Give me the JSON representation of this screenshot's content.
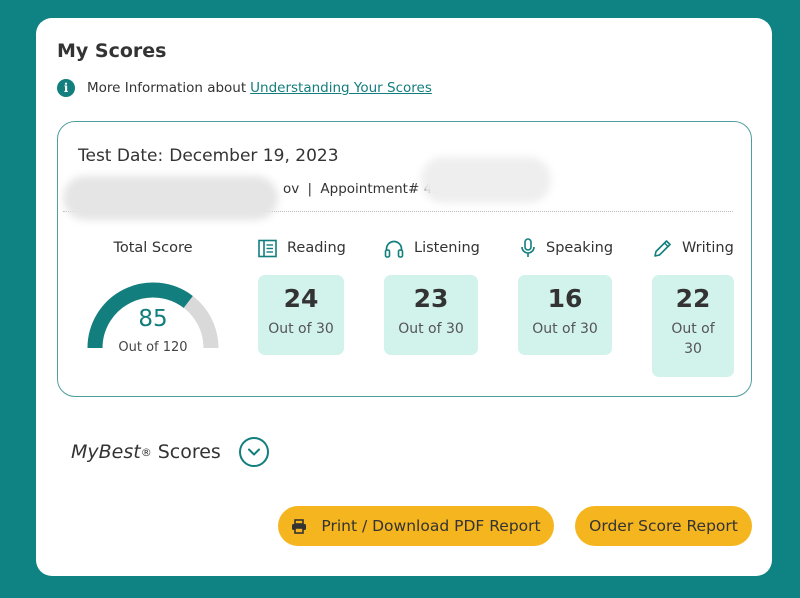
{
  "title": "My Scores",
  "info": {
    "text": "More Information about",
    "link": "Understanding Your Scores"
  },
  "test": {
    "date_label": "Test Date:",
    "date_value": "December 19, 2023",
    "name_suffix": "ov",
    "separator": "|",
    "appointment_label": "Appointment#",
    "appointment_partial": "432"
  },
  "total": {
    "label": "Total Score",
    "value": "85",
    "out_of": "Out of 120",
    "fraction": 0.708
  },
  "sections": [
    {
      "label": "Reading",
      "icon": "reading-icon",
      "score": "24",
      "out_of": "Out of 30"
    },
    {
      "label": "Listening",
      "icon": "headphones-icon",
      "score": "23",
      "out_of": "Out of 30"
    },
    {
      "label": "Speaking",
      "icon": "microphone-icon",
      "score": "16",
      "out_of": "Out of 30"
    },
    {
      "label": "Writing",
      "icon": "pencil-icon",
      "score": "22",
      "out_of": "Out of 30"
    }
  ],
  "mybest": {
    "prefix": "MyBest",
    "reg": "®",
    "suffix": "Scores"
  },
  "buttons": {
    "print": "Print / Download PDF Report",
    "order": "Order Score Report"
  },
  "colors": {
    "background": "#0f8383",
    "accent": "#127e7e",
    "score_box": "#d2f2ec",
    "button": "#f5b51f",
    "gauge_track": "#d9d9d9"
  }
}
